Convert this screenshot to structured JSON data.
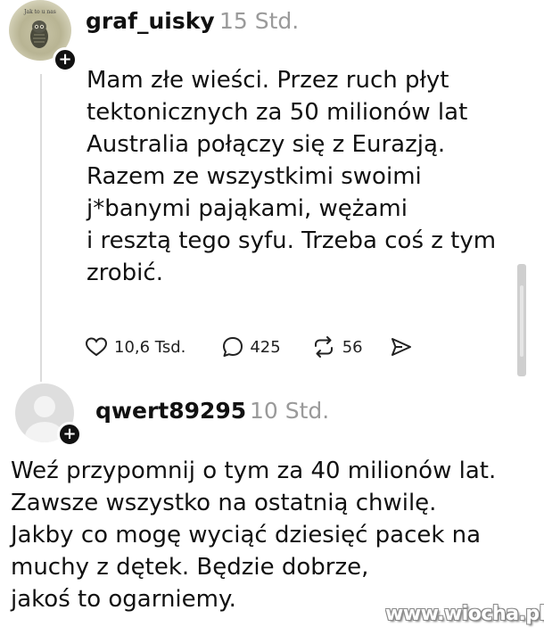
{
  "post1": {
    "avatar_caption": "Jak to u nas",
    "username": "graf_uisky",
    "time": "15 Std.",
    "text_lines": [
      "Mam złe wieści. Przez ruch płyt",
      "tektonicznych za 50 milionów lat",
      "Australia połączy się z Eurazją.",
      "Razem ze wszystkimi swoimi",
      "j*banymi pająkami, wężami",
      "i resztą tego syfu. Trzeba coś z tym",
      "zrobić."
    ],
    "likes": "10,6 Tsd.",
    "comments": "425",
    "reposts": "56",
    "icons": {
      "like": "heart-icon",
      "comment": "speech-bubble-icon",
      "repost": "repost-icon",
      "share": "send-icon",
      "follow": "plus-icon"
    }
  },
  "post2": {
    "username": "qwert89295",
    "time": "10 Std.",
    "text_lines": [
      "Weź przypomnij o tym za 40 milionów lat.",
      "Zawsze wszystko na ostatnią chwilę.",
      "Jakby co mogę wyciąć dziesięć pacek na",
      "muchy z dętek. Będzie dobrze,",
      "jakoś to ogarniemy."
    ]
  },
  "watermark": "www.wiocha.pl",
  "colors": {
    "text": "#111111",
    "muted": "#9a9a9a",
    "badge": "#111111",
    "thread_line": "#dcdcdc"
  }
}
